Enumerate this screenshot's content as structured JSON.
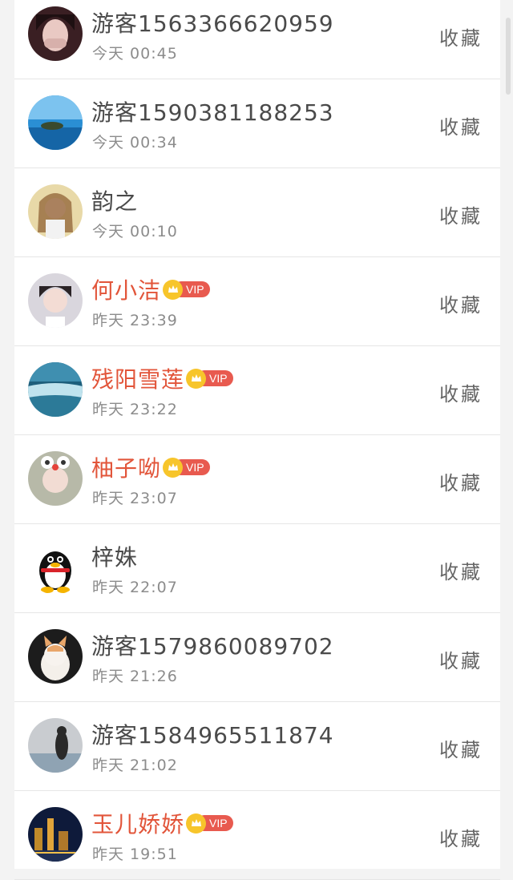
{
  "users": [
    {
      "name": "游客1563366620959",
      "time": "今天 00:45",
      "vip": false,
      "action": "收藏",
      "avatar_icon": "girl-portrait"
    },
    {
      "name": "游客1590381188253",
      "time": "今天 00:34",
      "vip": false,
      "action": "收藏",
      "avatar_icon": "ocean-island"
    },
    {
      "name": "韵之",
      "time": "今天 00:10",
      "vip": false,
      "action": "收藏",
      "avatar_icon": "anime-girl"
    },
    {
      "name": "何小洁",
      "time": "昨天 23:39",
      "vip": true,
      "action": "收藏",
      "avatar_icon": "girl-selfie"
    },
    {
      "name": "残阳雪莲",
      "time": "昨天 23:22",
      "vip": true,
      "action": "收藏",
      "avatar_icon": "waterfall"
    },
    {
      "name": "柚子呦",
      "time": "昨天 23:07",
      "vip": true,
      "action": "收藏",
      "avatar_icon": "cute-girl"
    },
    {
      "name": "梓姝",
      "time": "昨天 22:07",
      "vip": false,
      "action": "收藏",
      "avatar_icon": "qq-penguin"
    },
    {
      "name": "游客1579860089702",
      "time": "昨天 21:26",
      "vip": false,
      "action": "收藏",
      "avatar_icon": "kitten"
    },
    {
      "name": "游客1584965511874",
      "time": "昨天 21:02",
      "vip": false,
      "action": "收藏",
      "avatar_icon": "girl-seaside"
    },
    {
      "name": "玉儿娇娇",
      "time": "昨天 19:51",
      "vip": true,
      "action": "收藏",
      "avatar_icon": "city-night"
    }
  ],
  "vip_label": "VIP",
  "colors": {
    "accent": "#f5a623",
    "vip_name": "#e2553a",
    "vip_tag": "#e85a4f",
    "crown": "#f7c52b"
  }
}
